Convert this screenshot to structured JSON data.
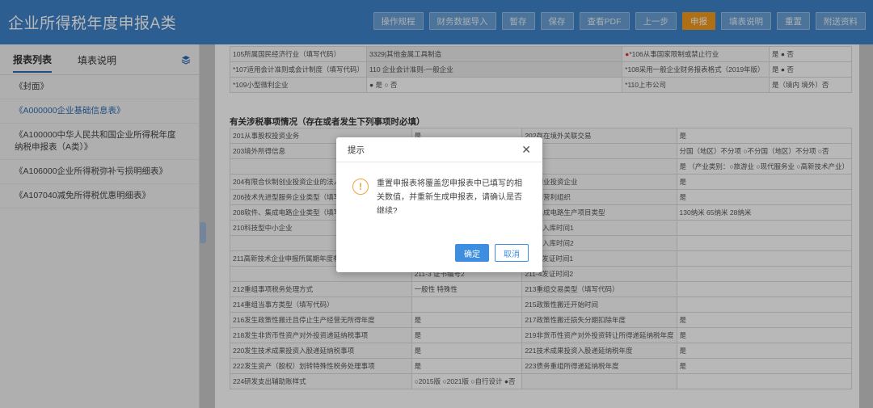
{
  "header": {
    "title": "企业所得税年度申报A类",
    "buttons": [
      {
        "label": "操作规程",
        "active": false
      },
      {
        "label": "财务数据导入",
        "active": false
      },
      {
        "label": "暂存",
        "active": false
      },
      {
        "label": "保存",
        "active": false
      },
      {
        "label": "查看PDF",
        "active": false
      },
      {
        "label": "上一步",
        "active": false
      },
      {
        "label": "申报",
        "active": true
      },
      {
        "label": "填表说明",
        "active": false
      },
      {
        "label": "重置",
        "active": false
      },
      {
        "label": "附送资料",
        "active": false
      }
    ]
  },
  "sidebar": {
    "tabs": [
      "报表列表",
      "填表说明"
    ],
    "items": [
      {
        "label": "《封面》"
      },
      {
        "label": "《A000000企业基础信息表》"
      },
      {
        "label": "《A100000中华人民共和国企业所得税年度纳税申报表（A类）》"
      },
      {
        "label": "《A106000企业所得税弥补亏损明细表》"
      },
      {
        "label": "《A107040减免所得税优惠明细表》"
      }
    ]
  },
  "form": {
    "top_rows": [
      {
        "l1": "105所属国民经济行业（填写代码）",
        "v1": "3329|其他金属工具制造",
        "l2": "*106从事国家限制或禁止行业",
        "v2": "是 ● 否"
      },
      {
        "l1": "*107适用会计准则或会计制度（填写代码）",
        "v1": "110 企业会计准则-一般企业",
        "l2": "*108采用一般企业财务报表格式（2019年版）",
        "v2": "是 ● 否"
      },
      {
        "l1": "*109小型微利企业",
        "v1": "● 是 ○ 否",
        "l2": "*110上市公司",
        "v2": "是（境内 境外）否"
      }
    ],
    "section_title": "有关涉税事项情况（存在或者发生下列事项时必填）",
    "rows": [
      {
        "l1": "201从事股权投资业务",
        "v1": "是",
        "l2": "202存在境外关联交易",
        "v2": "是"
      },
      {
        "l1": "203境外所得信息",
        "v1": "",
        "l2": "",
        "v2": "分国（地区）不分项 ○不分国（地区）不分项 ○否"
      },
      {
        "l1": "",
        "v1": "",
        "l2": "",
        "v2": "是 （产业类别：○旅游业 ○现代服务业 ○高新技术产业）"
      },
      {
        "l1": "204有限合伙制创业投资企业的法人",
        "v1": "",
        "l2": "205创业投资企业",
        "v2": "是"
      },
      {
        "l1": "206技术先进型服务企业类型（填写",
        "v1": "",
        "l2": "207非营利组织",
        "v2": "是"
      },
      {
        "l1": "208软件、集成电路企业类型（填写",
        "v1": "",
        "l2": "209集成电路生产项目类型",
        "v2": "130纳米 65纳米 28纳米"
      },
      {
        "l1": "210科技型中小企业",
        "v1": "",
        "l2": "210-2入库时间1",
        "v2": ""
      },
      {
        "l1": "",
        "v1": "",
        "l2": "210-4入库时间2",
        "v2": ""
      },
      {
        "l1": "211高新技术企业申报所属期年度有效的高新技术企业证书",
        "v1": "",
        "l2": "211-2发证时间1",
        "v2": ""
      },
      {
        "l1": "",
        "v1": "211-3 证书编号2",
        "l2": "211-4发证时间2",
        "v2": ""
      },
      {
        "l1": "212重组事项税务处理方式",
        "v1": "一般性 特殊性",
        "l2": "213重组交易类型（填写代码）",
        "v2": ""
      },
      {
        "l1": "214重组当事方类型（填写代码）",
        "v1": "",
        "l2": "215政策性搬迁开始时间",
        "v2": ""
      },
      {
        "l1": "216发生政策性搬迁且停止生产经营无所得年度",
        "v1": "是",
        "l2": "217政策性搬迁损失分期扣除年度",
        "v2": "是"
      },
      {
        "l1": "218发生非货币性资产对外投资递延纳税事项",
        "v1": "是",
        "l2": "219非货币性资产对外投资转让所得递延纳税年度",
        "v2": "是"
      },
      {
        "l1": "220发生技术成果投资入股递延纳税事项",
        "v1": "是",
        "l2": "221技术成果投资入股递延纳税年度",
        "v2": "是"
      },
      {
        "l1": "222发生资产（股权）划转特殊性税务处理事项",
        "v1": "是",
        "l2": "223债务重组所得递延纳税年度",
        "v2": "是"
      },
      {
        "l1": "224研发支出辅助账样式",
        "v1": "○2015版 ○2021版 ○自行设计 ●否",
        "l2": "",
        "v2": ""
      }
    ]
  },
  "dialog": {
    "title": "提示",
    "message": "重置申报表将覆盖您申报表中已填写的相关数值，并重新生成申报表，请确认是否继续?",
    "ok_label": "确定",
    "cancel_label": "取消"
  },
  "colors": {
    "header": "#3f83c9",
    "accent": "#f39b1e",
    "primary": "#3d8ee0"
  }
}
